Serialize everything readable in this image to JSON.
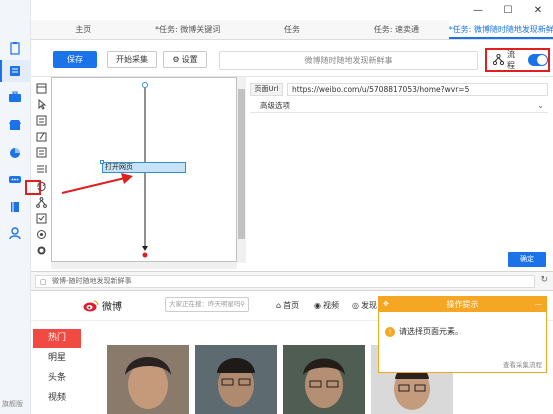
{
  "tabs": [
    {
      "label": "主页",
      "active": false
    },
    {
      "label": "*任务: 微博关键词",
      "active": false
    },
    {
      "label": "任务",
      "active": false
    },
    {
      "label": "任务: 速卖通",
      "active": false
    },
    {
      "label": "*任务: 微博随时随地发现新鲜事",
      "active": true
    }
  ],
  "toolbar": {
    "save_label": "保存",
    "start_label": "开始采集",
    "settings_label": "设置",
    "task_title": "微博随时随地发现新鲜事",
    "flow_label": "流程",
    "flow_toggle_on": true
  },
  "flow": {
    "node_open_page": "打开网页"
  },
  "properties": {
    "url_label": "页面Url",
    "url_value": "https://weibo.com/u/5708817053/home?wvr=5",
    "advanced_label": "高级选项",
    "confirm_label": "确定"
  },
  "browser": {
    "address": "微博-随时随地发现新鲜事"
  },
  "weibo": {
    "logo_text": "微博",
    "search_placeholder": "大家正在搜：昨天明星吗",
    "nav_home": "首页",
    "nav_video": "视频",
    "nav_discover": "发现",
    "sidebar": [
      "热门",
      "明星",
      "头条",
      "视频"
    ]
  },
  "tip": {
    "title": "操作提示",
    "message": "请选择页面元素。",
    "link": "查看采集流程"
  },
  "rail": {
    "bottom_label": "旗舰版"
  },
  "colors": {
    "primary": "#1a73e8",
    "highlight_red": "#e02020",
    "tip_orange": "#f5a623",
    "weibo_red": "#f04a42"
  }
}
